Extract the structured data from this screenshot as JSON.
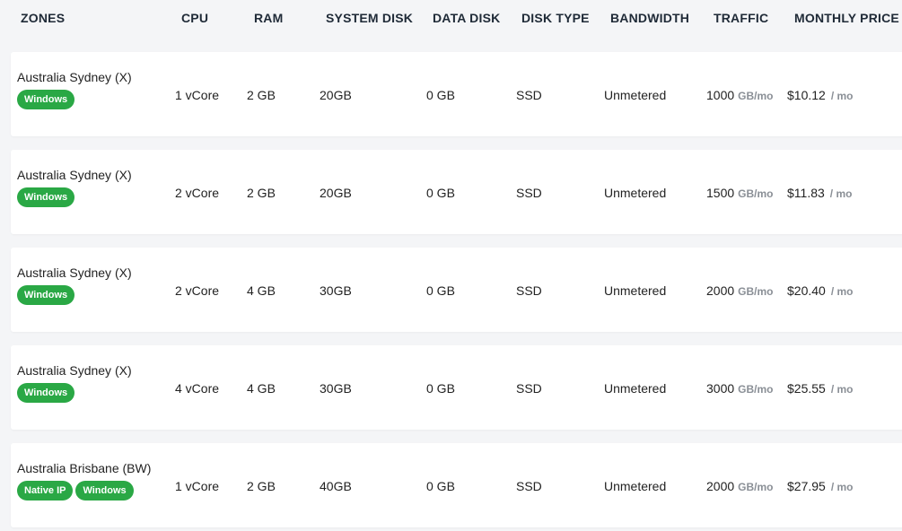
{
  "header": {
    "zones": "ZONES",
    "cpu": "CPU",
    "ram": "RAM",
    "system_disk": "SYSTEM DISK",
    "data_disk": "DATA DISK",
    "disk_type": "DISK TYPE",
    "bandwidth": "BANDWIDTH",
    "traffic": "TRAFFIC",
    "monthly_price": "MONTHLY PRICE"
  },
  "colors": {
    "badge": "#2aa845",
    "unit_text": "#8a8f96",
    "row_bg": "#ffffff",
    "page_bg": "#f4f5f7"
  },
  "plans": [
    {
      "zone": "Australia Sydney (X)",
      "badges": [
        "Windows"
      ],
      "cpu": "1 vCore",
      "ram": "2 GB",
      "system_disk": "20GB",
      "data_disk": "0 GB",
      "disk_type": "SSD",
      "bandwidth": "Unmetered",
      "traffic": "1000",
      "traffic_unit": "GB/mo",
      "price": "$10.12",
      "price_unit": "/ mo"
    },
    {
      "zone": "Australia Sydney (X)",
      "badges": [
        "Windows"
      ],
      "cpu": "2 vCore",
      "ram": "2 GB",
      "system_disk": "20GB",
      "data_disk": "0 GB",
      "disk_type": "SSD",
      "bandwidth": "Unmetered",
      "traffic": "1500",
      "traffic_unit": "GB/mo",
      "price": "$11.83",
      "price_unit": "/ mo"
    },
    {
      "zone": "Australia Sydney (X)",
      "badges": [
        "Windows"
      ],
      "cpu": "2 vCore",
      "ram": "4 GB",
      "system_disk": "30GB",
      "data_disk": "0 GB",
      "disk_type": "SSD",
      "bandwidth": "Unmetered",
      "traffic": "2000",
      "traffic_unit": "GB/mo",
      "price": "$20.40",
      "price_unit": "/ mo"
    },
    {
      "zone": "Australia Sydney (X)",
      "badges": [
        "Windows"
      ],
      "cpu": "4 vCore",
      "ram": "4 GB",
      "system_disk": "30GB",
      "data_disk": "0 GB",
      "disk_type": "SSD",
      "bandwidth": "Unmetered",
      "traffic": "3000",
      "traffic_unit": "GB/mo",
      "price": "$25.55",
      "price_unit": "/ mo"
    },
    {
      "zone": "Australia Brisbane (BW)",
      "badges": [
        "Native IP",
        "Windows"
      ],
      "cpu": "1 vCore",
      "ram": "2 GB",
      "system_disk": "40GB",
      "data_disk": "0 GB",
      "disk_type": "SSD",
      "bandwidth": "Unmetered",
      "traffic": "2000",
      "traffic_unit": "GB/mo",
      "price": "$27.95",
      "price_unit": "/ mo"
    }
  ]
}
